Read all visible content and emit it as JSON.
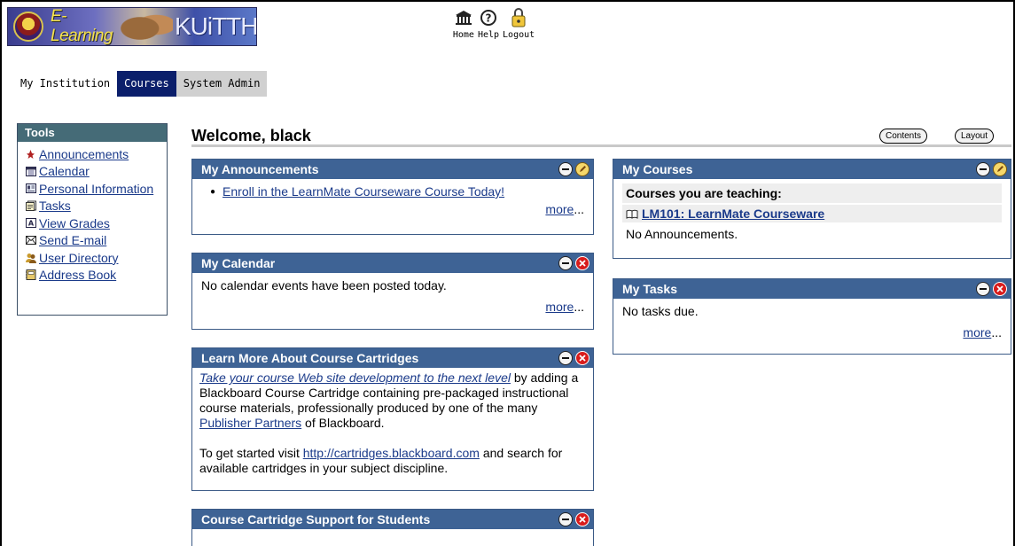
{
  "header": {
    "banner_text_1": "E-Learning",
    "banner_text_2": "KUiTTHO",
    "nav": [
      {
        "label": "Home",
        "icon": "home-icon"
      },
      {
        "label": "Help",
        "icon": "help-icon"
      },
      {
        "label": "Logout",
        "icon": "logout-icon"
      }
    ]
  },
  "tabs": [
    {
      "label": "My Institution",
      "state": "plain"
    },
    {
      "label": "Courses",
      "state": "active"
    },
    {
      "label": "System Admin",
      "state": "gray"
    }
  ],
  "tools": {
    "title": "Tools",
    "items": [
      {
        "label": "Announcements",
        "icon": "announcements-icon"
      },
      {
        "label": "Calendar",
        "icon": "calendar-icon"
      },
      {
        "label": "Personal Information",
        "icon": "personal-info-icon"
      },
      {
        "label": "Tasks",
        "icon": "tasks-icon"
      },
      {
        "label": "View Grades",
        "icon": "grades-icon"
      },
      {
        "label": "Send E-mail",
        "icon": "email-icon"
      },
      {
        "label": "User Directory",
        "icon": "user-directory-icon"
      },
      {
        "label": "Address Book",
        "icon": "address-book-icon"
      }
    ]
  },
  "welcome": {
    "title": "Welcome, black",
    "contents_button": "Contents",
    "layout_button": "Layout"
  },
  "modules": {
    "announcements": {
      "title": "My Announcements",
      "item": "Enroll in the LearnMate Courseware Course Today!",
      "more": "more",
      "ellipsis": "..."
    },
    "calendar": {
      "title": "My Calendar",
      "text": "No calendar events have been posted today.",
      "more": "more",
      "ellipsis": "..."
    },
    "cartridges": {
      "title": "Learn More About Course Cartridges",
      "p1_link": "Take your course Web site development to the next level",
      "p1_a": " by adding a Blackboard Course Cartridge containing pre-packaged instructional course materials, professionally produced by one of the many ",
      "p1_link2": "Publisher Partners",
      "p1_b": " of Blackboard.",
      "p2_a": "To get started visit ",
      "p2_link": "http://cartridges.blackboard.com",
      "p2_b": " and search for available cartridges in your subject discipline."
    },
    "support": {
      "title": "Course Cartridge Support for Students"
    },
    "courses": {
      "title": "My Courses",
      "teaching_label": "Courses you are teaching:",
      "course": "LM101: LearnMate Courseware",
      "note": "No Announcements."
    },
    "tasks": {
      "title": "My Tasks",
      "text": "No tasks due.",
      "more": "more",
      "ellipsis": "..."
    }
  },
  "colors": {
    "module_header": "#3e6395",
    "tools_header": "#456b77",
    "active_tab": "#0b1f6b"
  }
}
